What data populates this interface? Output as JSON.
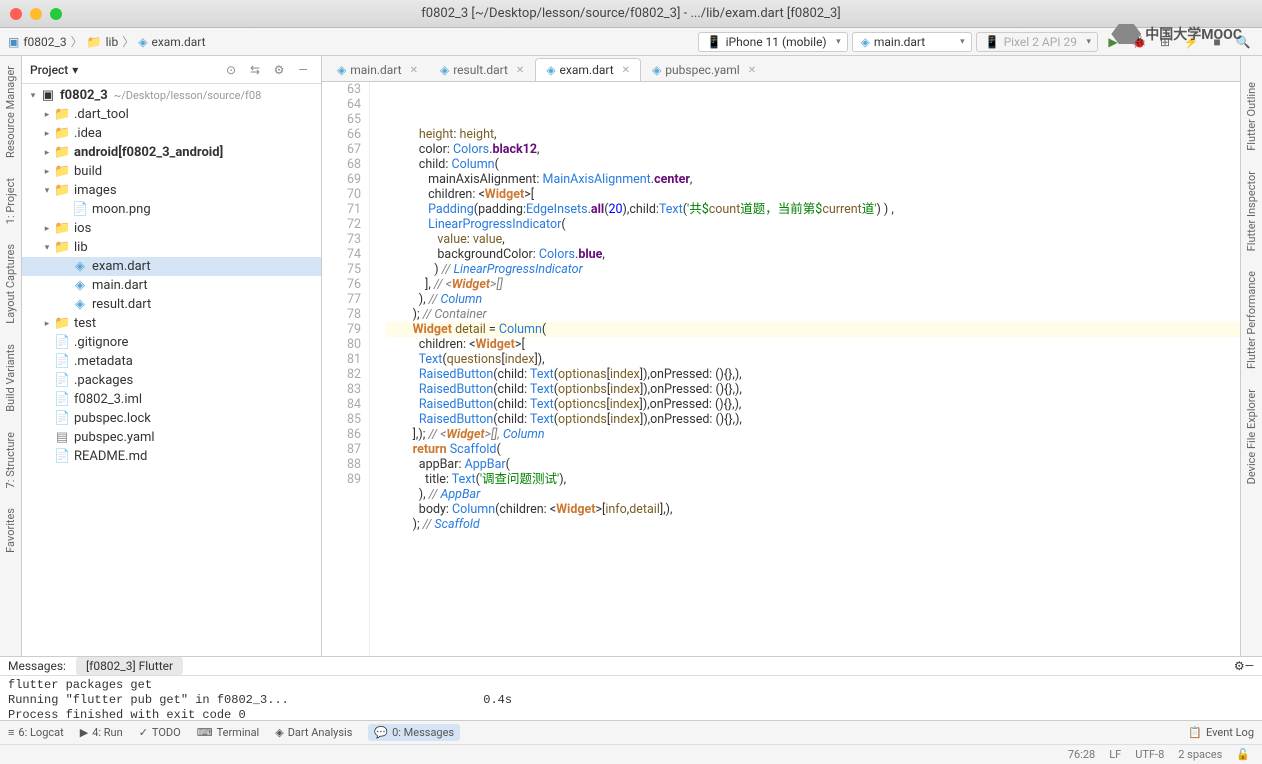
{
  "window": {
    "title": "f0802_3 [~/Desktop/lesson/source/f0802_3] - .../lib/exam.dart [f0802_3]"
  },
  "breadcrumb": {
    "project": "f0802_3",
    "folder": "lib",
    "file": "exam.dart"
  },
  "toolbar": {
    "device": "iPhone 11 (mobile)",
    "config": "main.dart",
    "emulator": "Pixel 2 API 29"
  },
  "mooc": {
    "text": "中国大学MOOC"
  },
  "projectPanel": {
    "title": "Project"
  },
  "tree": {
    "root": "f0802_3",
    "rootPath": "~/Desktop/lesson/source/f08",
    "items": [
      {
        "name": ".dart_tool",
        "type": "folder",
        "indent": 1,
        "arrow": "▸"
      },
      {
        "name": ".idea",
        "type": "folder",
        "indent": 1,
        "arrow": "▸"
      },
      {
        "name": "android",
        "suffix": "[f0802_3_android]",
        "type": "folder",
        "indent": 1,
        "arrow": "▸",
        "bold": true
      },
      {
        "name": "build",
        "type": "folder",
        "indent": 1,
        "arrow": "▸"
      },
      {
        "name": "images",
        "type": "folder",
        "indent": 1,
        "arrow": "▾"
      },
      {
        "name": "moon.png",
        "type": "file",
        "indent": 2
      },
      {
        "name": "ios",
        "type": "folder",
        "indent": 1,
        "arrow": "▸"
      },
      {
        "name": "lib",
        "type": "folder",
        "indent": 1,
        "arrow": "▾"
      },
      {
        "name": "exam.dart",
        "type": "dart",
        "indent": 2,
        "selected": true
      },
      {
        "name": "main.dart",
        "type": "dart",
        "indent": 2
      },
      {
        "name": "result.dart",
        "type": "dart",
        "indent": 2
      },
      {
        "name": "test",
        "type": "folder",
        "indent": 1,
        "arrow": "▸"
      },
      {
        "name": ".gitignore",
        "type": "file",
        "indent": 1
      },
      {
        "name": ".metadata",
        "type": "file",
        "indent": 1
      },
      {
        "name": ".packages",
        "type": "file",
        "indent": 1
      },
      {
        "name": "f0802_3.iml",
        "type": "file",
        "indent": 1
      },
      {
        "name": "pubspec.lock",
        "type": "file",
        "indent": 1
      },
      {
        "name": "pubspec.yaml",
        "type": "yaml",
        "indent": 1
      },
      {
        "name": "README.md",
        "type": "file",
        "indent": 1
      }
    ]
  },
  "editorTabs": [
    {
      "label": "main.dart",
      "active": false
    },
    {
      "label": "result.dart",
      "active": false
    },
    {
      "label": "exam.dart",
      "active": true
    },
    {
      "label": "pubspec.yaml",
      "active": false
    }
  ],
  "code": {
    "startLine": 63,
    "lines": [
      "        height: height,",
      "        color: Colors.black12,",
      "        child: Column(",
      "           mainAxisAlignment: MainAxisAlignment.center,",
      "           children: <Widget>[",
      "           Padding(padding:EdgeInsets.all(20),child:Text('共$count道题，当前第$current道') ) ,",
      "           LinearProgressIndicator(",
      "              value: value,",
      "              backgroundColor: Colors.blue,",
      "             ) // LinearProgressIndicator",
      "          ], // <Widget>[]",
      "        ), // Column",
      "      ); // Container",
      "      Widget detail = Column(",
      "        children: <Widget>[",
      "        Text(questions[index]),",
      "        RaisedButton(child: Text(optionas[index]),onPressed: (){},),",
      "        RaisedButton(child: Text(optionbs[index]),onPressed: (){},),",
      "        RaisedButton(child: Text(optioncs[index]),onPressed: (){},),",
      "        RaisedButton(child: Text(optionds[index]),onPressed: (){},),",
      "      ],); // <Widget>[], Column",
      "      return Scaffold(",
      "        appBar: AppBar(",
      "          title: Text('调查问题测试'),",
      "        ), // AppBar",
      "        body: Column(children: <Widget>[info,detail],),",
      "      ); // Scaffold"
    ]
  },
  "messages": {
    "title": "Messages:",
    "tab": "[f0802_3] Flutter",
    "body": "flutter packages get\nRunning \"flutter pub get\" in f0802_3...                           0.4s\nProcess finished with exit code 0"
  },
  "bottomBar": {
    "logcat": "6: Logcat",
    "run": "4: Run",
    "todo": "TODO",
    "terminal": "Terminal",
    "dart": "Dart Analysis",
    "msgs": "0: Messages",
    "eventlog": "Event Log"
  },
  "status": {
    "pos": "76:28",
    "lf": "LF",
    "enc": "UTF-8",
    "indent": "2 spaces"
  },
  "leftRail": {
    "project": "1: Project",
    "res": "Resource Manager",
    "structure": "7: Structure",
    "build": "Build Variants",
    "layout": "Layout Captures",
    "fav": "Favorites"
  },
  "rightRail": {
    "outline": "Flutter Outline",
    "inspector": "Flutter Inspector",
    "performance": "Flutter Performance",
    "device": "Device File Explorer"
  }
}
